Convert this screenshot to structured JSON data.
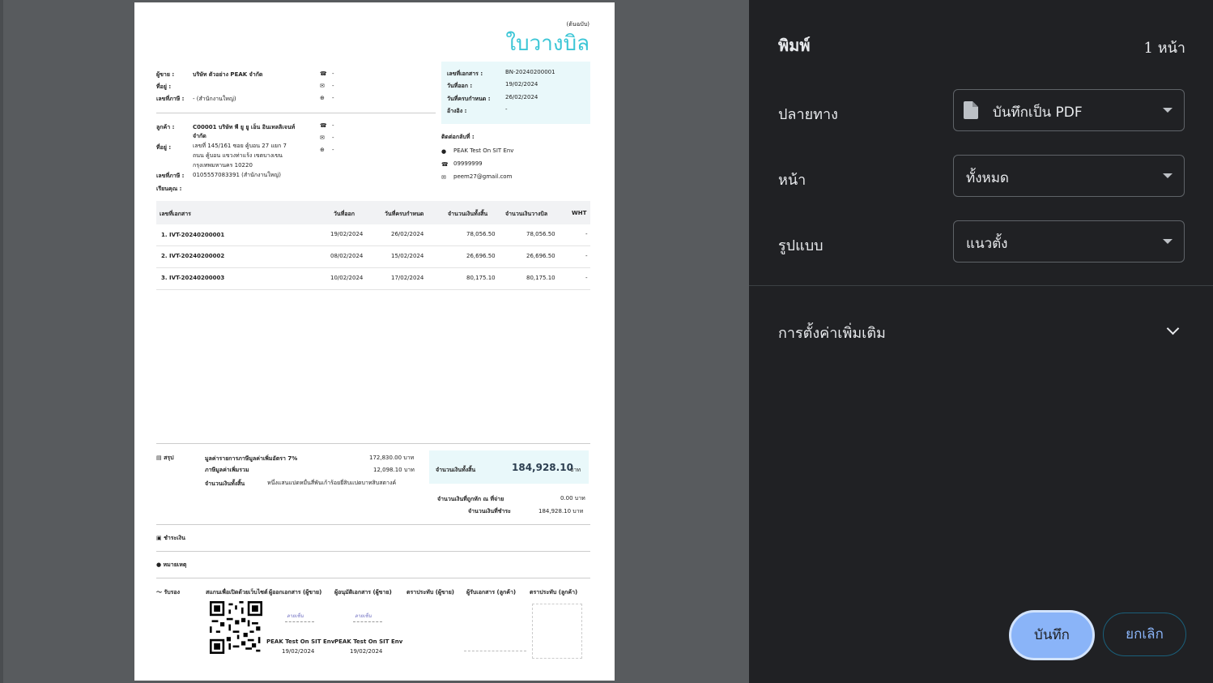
{
  "panel": {
    "title": "พิมพ์",
    "page_count": "1 หน้า",
    "destination_label": "ปลายทาง",
    "destination_value": "บันทึกเป็น PDF",
    "pages_label": "หน้า",
    "pages_value": "ทั้งหมด",
    "layout_label": "รูปแบบ",
    "layout_value": "แนวตั้ง",
    "more_settings": "การตั้งค่าเพิ่มเติม",
    "save_button": "บันทึก",
    "cancel_button": "ยกเลิก"
  },
  "doc": {
    "original_tag": "(ต้นฉบับ)",
    "title": "ใบวางบิล",
    "seller_label": "ผู้ขาย :",
    "seller_name": "บริษัท ตัวอย่าง PEAK จำกัด",
    "address_label": "ที่อยู่ :",
    "taxid_label": "เลขที่ภาษี :",
    "seller_taxid": "- (สำนักงานใหญ่)",
    "dash": "-",
    "doc_no_label": "เลขที่เอกสาร :",
    "doc_no": "BN-20240200001",
    "issue_label": "วันที่ออก :",
    "issue_date": "19/02/2024",
    "due_label": "วันที่ครบกำหนด :",
    "due_date": "26/02/2024",
    "ref_label": "อ้างอิง :",
    "ref": "-",
    "customer_label": "ลูกค้า :",
    "customer_name_1": "C00001 บริษัท พี ยู ยู เอ็น อินเทลลิเจนท์",
    "customer_name_2": "จำกัด",
    "customer_addr_1": "เลขที่ 145/161    ซอย คู้บอน 27 แยก 7",
    "customer_addr_2": "ถนน คู้บอน  แขวงท่าแร้ง เขตบางเขน",
    "customer_addr_3": "กรุงเทพมหานคร 10220",
    "customer_taxid": "0105557083391 (สำนักงานใหญ่)",
    "attention_label": "เรียนคุณ :",
    "contact_label": "ติดต่อกลับที่ :",
    "contact_name": "PEAK Test On SIT Env",
    "contact_phone": "09999999",
    "contact_email": "peem27@gmail.com",
    "table_headers": [
      "เลขที่เอกสาร",
      "วันที่ออก",
      "วันที่ครบกำหนด",
      "จำนวนเงินทั้งสิ้น",
      "จำนวนเงินวางบิล",
      "WHT"
    ],
    "rows": [
      {
        "no": "1.",
        "id": "IVT-20240200001",
        "issue": "19/02/2024",
        "due": "26/02/2024",
        "total": "78,056.50",
        "billed": "78,056.50",
        "wht": "-"
      },
      {
        "no": "2.",
        "id": "IVT-20240200002",
        "issue": "08/02/2024",
        "due": "15/02/2024",
        "total": "26,696.50",
        "billed": "26,696.50",
        "wht": "-"
      },
      {
        "no": "3.",
        "id": "IVT-20240200003",
        "issue": "10/02/2024",
        "due": "17/02/2024",
        "total": "80,175.10",
        "billed": "80,175.10",
        "wht": "-"
      }
    ],
    "summary_label": "สรุป",
    "vat_base_label": "มูลค่ารายการภาษีมูลค่าเพิ่มอัตรา 7%",
    "vat_base_value": "172,830.00 บาท",
    "vat_label": "ภาษีมูลค่าเพิ่มรวม",
    "vat_value": "12,098.10 บาท",
    "grand_label": "จำนวนเงินทั้งสิ้น",
    "grand_text": "หนึ่งแสนแปดหมื่นสี่พันเก้าร้อยยี่สิบแปดบาทสิบสตางค์",
    "total_box_label": "จำนวนเงินทั้งสิ้น",
    "total_box_value": "184,928.10",
    "baht": "บาท",
    "withholding_label": "จำนวนเงินที่ถูกหัก ณ ที่จ่าย",
    "withholding_value": "0.00 บาท",
    "payable_label": "จำนวนเงินที่ชำระ",
    "payable_value": "184,928.10 บาท",
    "payment_label": "ชำระเงิน",
    "remark_label": "หมายเหตุ",
    "certify_label": "รับรอง",
    "sig_headers": [
      "สแกนเพื่อเปิดด้วยเว็บไซต์",
      "ผู้ออกเอกสาร (ผู้ขาย)",
      "ผู้อนุมัติเอกสาร (ผู้ขาย)",
      "ตราประทับ (ผู้ขาย)",
      "ผู้รับเอกสาร (ลูกค้า)",
      "ตราประทับ (ลูกค้า)"
    ],
    "sig_name_1": "PEAK Test On SIT Env",
    "sig_name_2": "PEAK Test On SIT Env",
    "sig_date_1": "19/02/2024",
    "sig_date_2": "19/02/2024"
  }
}
